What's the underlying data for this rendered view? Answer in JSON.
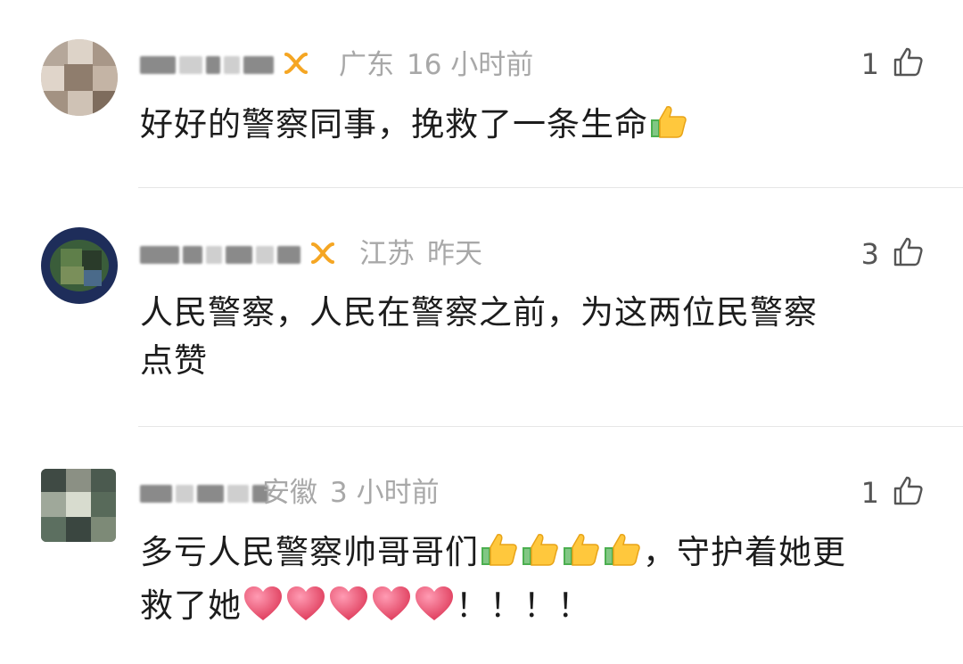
{
  "comments": [
    {
      "region": "广东",
      "time": "16 小时前",
      "likes": "1",
      "text": "好好的警察同事，挽救了一条生命",
      "text_emojis": [
        "thumbs-up"
      ],
      "vip": true
    },
    {
      "region": "江苏",
      "time": "昨天",
      "likes": "3",
      "text_line1": "人民警察，人民在警察之前，为这两位民警察",
      "text_line2": "点赞",
      "vip": true
    },
    {
      "region": "安徽",
      "time": "3 小时前",
      "likes": "1",
      "text_part1": "多亏人民警察帅哥哥们",
      "text_part2": "，守护着她更",
      "text_part3": "救了她",
      "text_part4": "！！！！",
      "text_emojis": [
        "thumbs-up",
        "thumbs-up",
        "thumbs-up",
        "thumbs-up",
        "heart",
        "heart",
        "heart",
        "heart",
        "heart"
      ],
      "vip": false
    }
  ],
  "colors": {
    "meta": "#a8a8a8",
    "vip": "#f5a623",
    "divider": "#e6e6e6"
  }
}
